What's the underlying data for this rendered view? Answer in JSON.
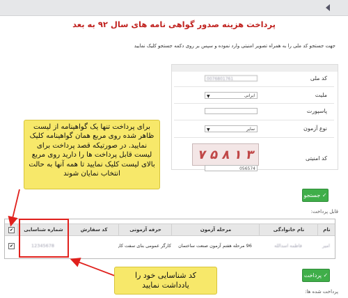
{
  "page_title": "پرداخت هزینه صدور گواهی نامه های سال ۹۲ به بعد",
  "instructions": "جهت جستجو کد ملی را به همراه تصویر امنیتی وارد نموده و سپس بر روی دکمه جستجو کلیک نمایید",
  "form": {
    "national_code_label": "کد ملی",
    "national_code_value": "0076801761",
    "nationality_label": "ملیت",
    "nationality_value": "ایرانی",
    "passport_label": "پاسپورت",
    "passport_value": "",
    "exam_type_label": "نوع آزمون",
    "exam_type_value": "سایر",
    "security_code_label": "کد امنیتی",
    "captcha_text": "۷ ۵ ۸ ۱ ۳",
    "security_code_value": "056574"
  },
  "buttons": {
    "search": "جستجو",
    "payment": "پرداخت"
  },
  "payable_label": "قابل پرداخت:",
  "paid_label": "پرداخت شده ها:",
  "table": {
    "headers": {
      "first_name": "نام",
      "last_name": "نام خانوادگی",
      "exam_stage": "مرحله آزمون",
      "exam_profession": "حرفه آزمونی",
      "order_code": "کد سفارش",
      "tracking_number": "شماره شناسایی"
    },
    "row": {
      "first_name": "امیر",
      "last_name": "فاطمه اسدالله",
      "exam_stage": "96 مرحله هفتم آزمون صنعت ساختمان",
      "exam_profession": "کارگر عمومی بنای سفت کار",
      "order_code": "",
      "tracking_number": "12345678"
    }
  },
  "callouts": {
    "select_instruction": "برای پرداخت تنها یک گواهینامه از لیست ظاهر شده روی مربع همان گواهینامه کلیک نمایید. در صورتیکه قصد پرداخت برای لیست قابل پرداخت ها را دارید روی مربع بالای لیست کلیک نمایید تا همه آنها به حالت انتخاب نمایان شوند",
    "tracking_instruction": "کد شناسایی خود را یادداشت نمایید"
  },
  "icons": {
    "back": "triangle-left-icon",
    "check": "check-icon",
    "dropdown": "dropdown-arrow-icon"
  },
  "colors": {
    "title_red": "#c0221f",
    "button_green": "#3fae49",
    "callout_yellow": "#f7e86a",
    "highlight_red": "#e0201c"
  }
}
